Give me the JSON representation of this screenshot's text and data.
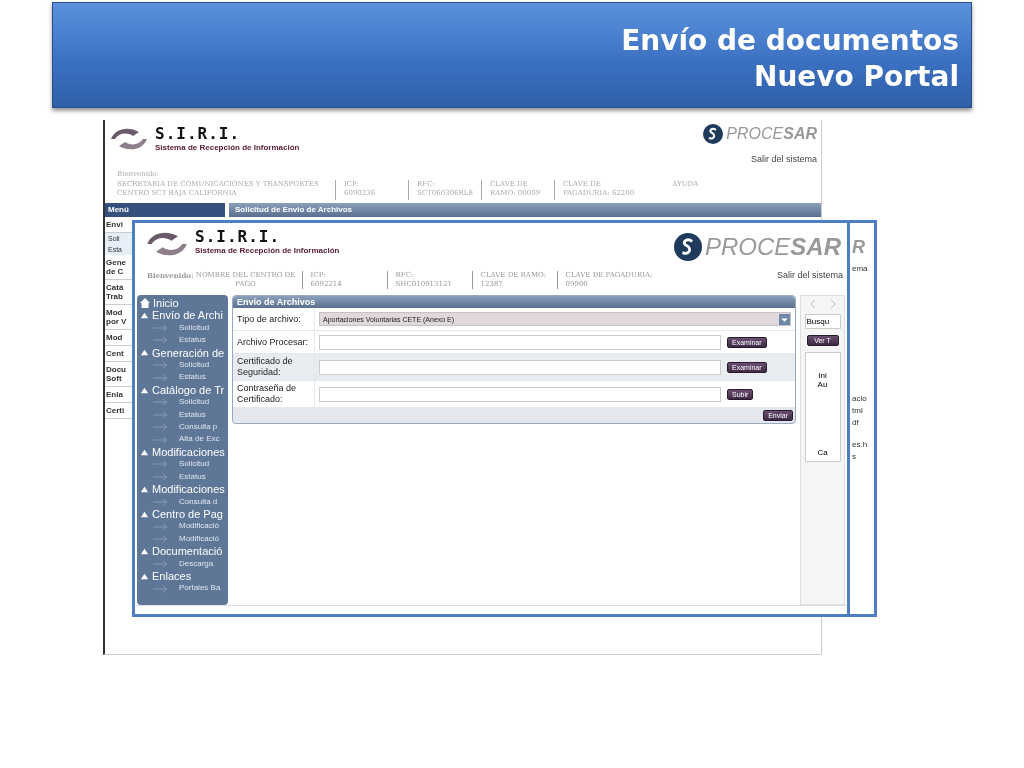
{
  "slide": {
    "title_lines": [
      "Envío de documentos",
      "Nuevo Portal"
    ]
  },
  "back_screen": {
    "logo_title": "S.I.R.I.",
    "logo_subtitle": "Sistema de Recepción de Información",
    "brand": "PROCE**SAR**",
    "logout": "Salir del sistema",
    "welcome": "Bienvenido:",
    "info": [
      {
        "lines": [
          "SECRETARIA DE COMUNICACIONES Y TRANSPORTES",
          "CENTRO SCT BAJA CALIFORNIA"
        ]
      },
      {
        "lines": [
          "ICP:",
          "6090236"
        ]
      },
      {
        "lines": [
          "RFC:",
          "SCT060306RL8"
        ]
      },
      {
        "lines": [
          "CLAVE DE",
          "RAMO: 00009"
        ]
      },
      {
        "lines": [
          "CLAVE DE",
          "PAGADURIA: 62200"
        ]
      }
    ],
    "help": "AYUDA",
    "menu_title": "Menú",
    "tab_title": "Solicitud de Envio de Archivos",
    "menu_items": [
      {
        "label": "Envi",
        "kind": "group"
      },
      {
        "label": "Soli",
        "kind": "sub"
      },
      {
        "label": "Esta",
        "kind": "sub"
      },
      {
        "label": "Gene de C",
        "kind": "group"
      },
      {
        "label": "Catá Trab",
        "kind": "group"
      },
      {
        "label": "Mod por V",
        "kind": "group"
      },
      {
        "label": "Mod",
        "kind": "group"
      },
      {
        "label": "Cent",
        "kind": "group"
      },
      {
        "label": "Docu Soft",
        "kind": "group"
      },
      {
        "label": "Enla",
        "kind": "group"
      },
      {
        "label": "Certi",
        "kind": "group"
      }
    ],
    "right_fragments": {
      "brand": "R",
      "logout": "ema",
      "links": [
        "acio",
        "tml",
        "df"
      ],
      "files": [
        "es.h",
        "s"
      ]
    }
  },
  "front_screen": {
    "logo_title": "S.I.R.I.",
    "logo_subtitle": "Sistema de Recepción de Información",
    "brand": "PROCE**SAR**",
    "logout": "Salir del sistema",
    "welcome": "Bienvenido:",
    "center_name": "NOMBRE DEL CENTRO DE PAGO",
    "info": [
      {
        "lines": [
          "ICP:",
          "6092214"
        ]
      },
      {
        "lines": [
          "RFC:",
          "SHC010913121"
        ]
      },
      {
        "lines": [
          "CLAVE DE RAMO:",
          "12387"
        ]
      },
      {
        "lines": [
          "CLAVE DE PAGADURIA:",
          "09900"
        ]
      }
    ],
    "tree": [
      {
        "label": "Inicio",
        "kind": "home"
      },
      {
        "label": "Envío de Archi",
        "kind": "group",
        "expanded": true,
        "children": [
          {
            "label": "Solicitud"
          },
          {
            "label": "Estatus"
          }
        ]
      },
      {
        "label": "Generación de",
        "kind": "group",
        "expanded": true,
        "children": [
          {
            "label": "Solicitud"
          },
          {
            "label": "Estatus"
          }
        ]
      },
      {
        "label": "Catálogo de Tr",
        "kind": "group",
        "expanded": true,
        "children": [
          {
            "label": "Solicitud"
          },
          {
            "label": "Estatus"
          },
          {
            "label": "Consulta p"
          },
          {
            "label": "Alta de Exc"
          }
        ]
      },
      {
        "label": "Modificaciones",
        "kind": "group",
        "expanded": true,
        "children": [
          {
            "label": "Solicitud"
          },
          {
            "label": "Estatus"
          }
        ]
      },
      {
        "label": "Modificaciones",
        "kind": "group",
        "expanded": true,
        "children": [
          {
            "label": "Consulta d"
          }
        ]
      },
      {
        "label": "Centro de Pag",
        "kind": "group",
        "expanded": true,
        "children": [
          {
            "label": "Modificació"
          },
          {
            "label": "Modificació"
          }
        ]
      },
      {
        "label": "Documentació",
        "kind": "group",
        "expanded": true,
        "children": [
          {
            "label": "Descarga"
          }
        ]
      },
      {
        "label": "Enlaces",
        "kind": "group",
        "expanded": true,
        "children": [
          {
            "label": "Portales Ba"
          }
        ]
      }
    ],
    "form": {
      "title": "Envío de Archivos",
      "rows": [
        {
          "kind": "select",
          "label": "Tipo de archivo:",
          "value": "Aportaciones Voluntarias CETE (Anexo E)"
        },
        {
          "kind": "file",
          "label": "Archivo Procesar:",
          "button": "Examinar"
        },
        {
          "kind": "file",
          "label": "Certificado de Seguridad:",
          "button": "Examinar"
        },
        {
          "kind": "password",
          "label": "Contraseña de Certificado:",
          "button": "Subir"
        }
      ],
      "submit": "Enviar"
    },
    "side_panel": {
      "search": "Busqu",
      "button": "Ver T",
      "items": [
        "Ini",
        "Au"
      ],
      "footer": "Ca"
    }
  }
}
